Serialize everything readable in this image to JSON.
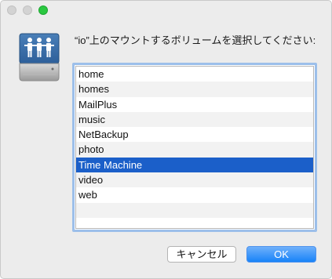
{
  "dialog": {
    "prompt": "“io”上のマウントするボリュームを選択してください:",
    "volumes": [
      {
        "label": "home",
        "selected": false
      },
      {
        "label": "homes",
        "selected": false
      },
      {
        "label": "MailPlus",
        "selected": false
      },
      {
        "label": "music",
        "selected": false
      },
      {
        "label": "NetBackup",
        "selected": false
      },
      {
        "label": "photo",
        "selected": false
      },
      {
        "label": "Time Machine",
        "selected": true
      },
      {
        "label": "video",
        "selected": false
      },
      {
        "label": "web",
        "selected": false
      }
    ],
    "cancel_label": "キャンセル",
    "ok_label": "OK"
  },
  "icons": {
    "server": "network-share-drive-icon"
  },
  "colors": {
    "selection": "#1b5fc9",
    "focus_ring": "#9cbfea",
    "ok_button": "#1883f8"
  }
}
